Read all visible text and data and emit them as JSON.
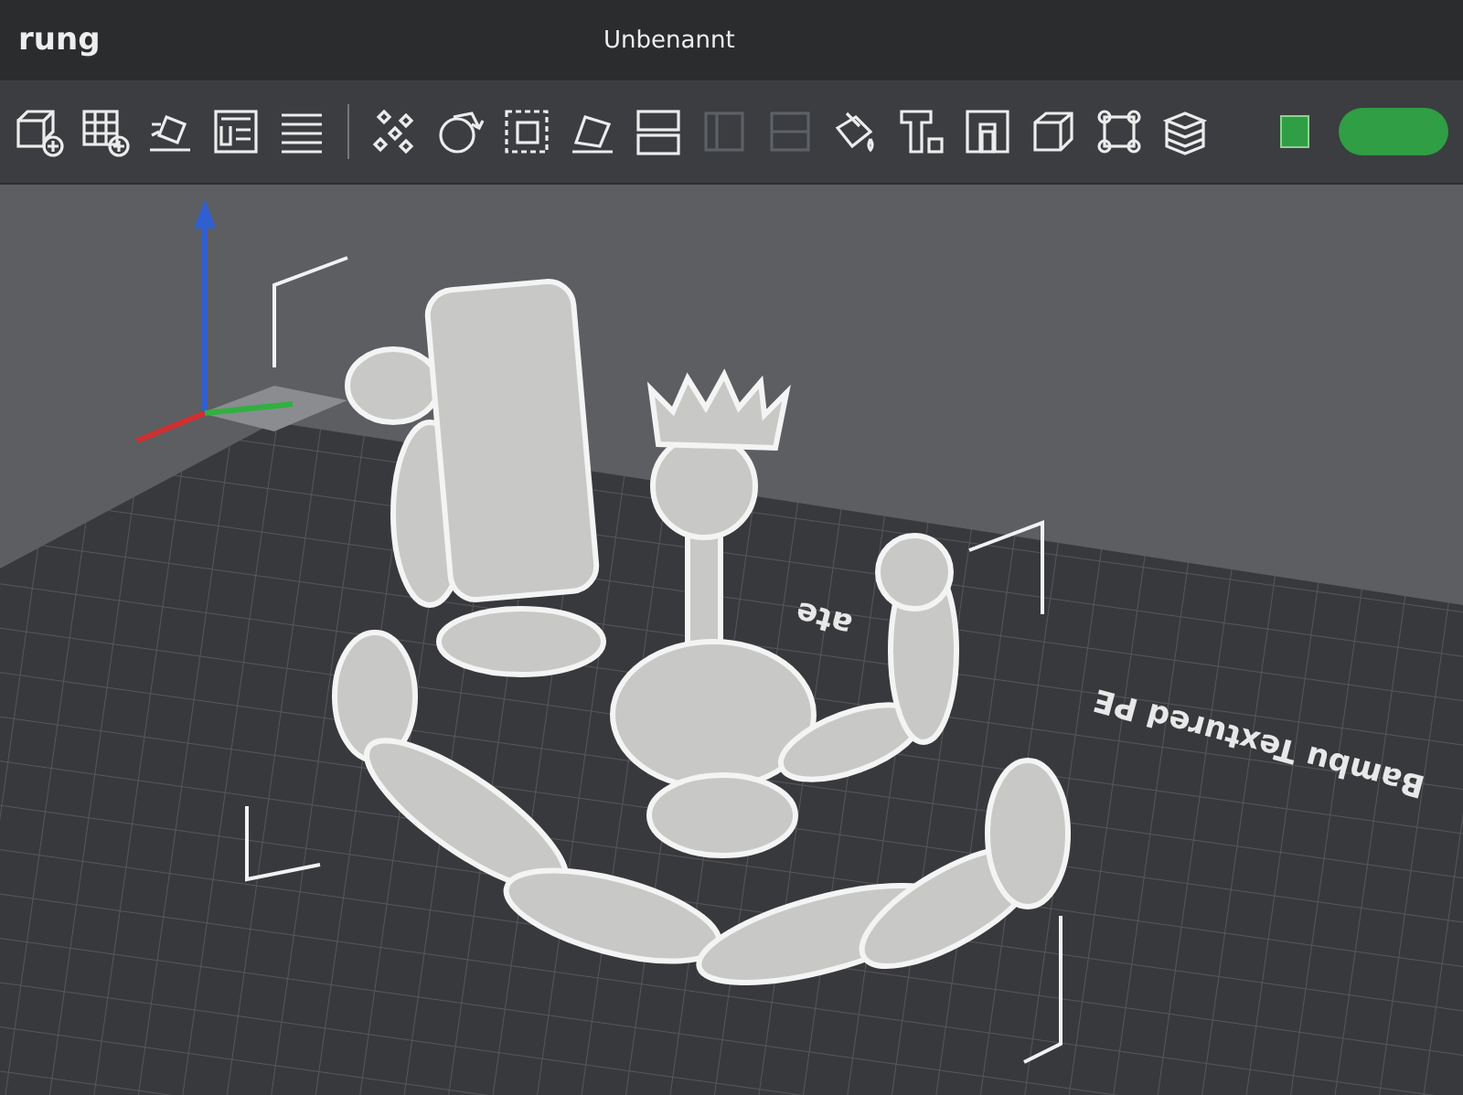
{
  "tab_label": "rung",
  "window": {
    "title": "Unbenannt"
  },
  "toolbar": {
    "groups": [
      [
        {
          "disabled": false
        },
        {
          "disabled": false
        },
        {
          "disabled": false
        },
        {
          "disabled": false
        },
        {
          "disabled": false
        }
      ],
      [
        {
          "disabled": false
        },
        {
          "disabled": false
        },
        {
          "disabled": false
        },
        {
          "disabled": false
        },
        {
          "disabled": false
        },
        {
          "disabled": true
        },
        {
          "disabled": true
        },
        {
          "disabled": false
        },
        {
          "disabled": false
        },
        {
          "disabled": false
        },
        {
          "disabled": false
        },
        {
          "disabled": false
        },
        {
          "disabled": false
        }
      ]
    ]
  },
  "plate_label": [
    {
      "text": "Bambu Textured PE"
    },
    {
      "text": "ate"
    }
  ]
}
